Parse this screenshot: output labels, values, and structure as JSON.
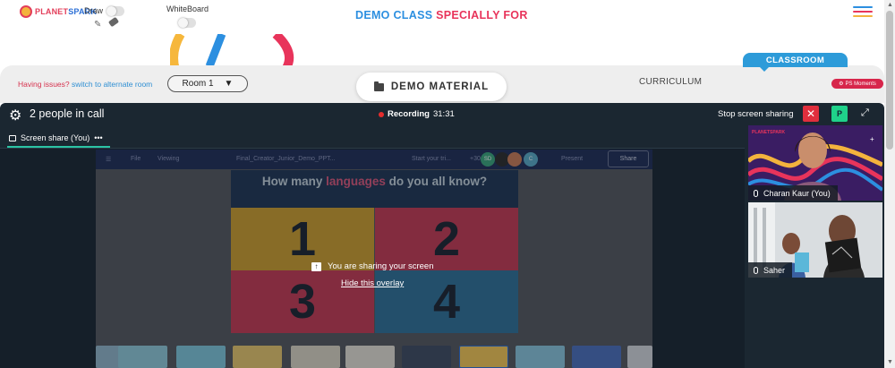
{
  "topbar": {
    "logo_text_a": "PLANET",
    "logo_text_b": "SPARK",
    "draw_label": "Draw",
    "whiteboard_label": "WhiteBoard",
    "title_a": "DEMO CLASS",
    "title_b": "SPECIALLY FOR"
  },
  "header": {
    "issues_text": "Having issues?",
    "alternate_link": "switch to alternate room",
    "room_value": "Room 1",
    "demo_material": "DEMO MATERIAL",
    "curriculum": "CURRICULUM",
    "classroom": "CLASSROOM",
    "ps_moments": "PS Moments"
  },
  "call": {
    "people_count": "2 people in call",
    "recording_label": "Recording",
    "recording_time": "31:31",
    "stop_share": "Stop screen sharing",
    "p_badge": "P",
    "screen_share_tab": "Screen share (You)",
    "tab_more": "•••"
  },
  "shared_screen": {
    "canva_menu": [
      "File",
      "Viewing",
      "Final_Creator_Junior_Demo_PPT...",
      "Start your tri...",
      "Present",
      "Share"
    ],
    "avatar_more": "+30",
    "avatar_sd": "SD",
    "avatar_c": "C",
    "slide_question_a": "How many",
    "slide_question_hl": "languages",
    "slide_question_b": "do you all know?",
    "numbers": [
      "1",
      "2",
      "3",
      "4"
    ],
    "overlay_message": "You are sharing your screen",
    "overlay_hide": "Hide this overlay"
  },
  "participants": [
    {
      "name": "Charan Kaur (You)"
    },
    {
      "name": "Saher"
    }
  ],
  "colors": {
    "brand_red": "#e8345b",
    "brand_blue": "#2c8fe0",
    "call_bg": "#1b2731",
    "accent_green": "#2bc3a4"
  }
}
